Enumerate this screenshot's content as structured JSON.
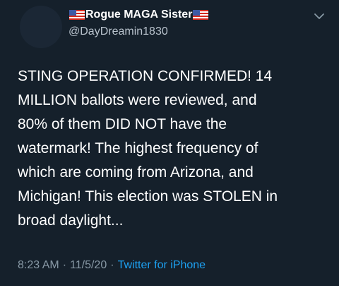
{
  "tweet": {
    "display_name": "Rogue MAGA Sister",
    "handle": "@DayDreamin1830",
    "body": "STING OPERATION CONFIRMED! 14\nMILLION ballots were reviewed, and\n80% of them DID NOT have the\nwatermark! The highest frequency of\nwhich are coming from Arizona, and\nMichigan! This election was STOLEN in\nbroad daylight...",
    "time": "8:23 AM",
    "date": "11/5/20",
    "separator": "·",
    "source": "Twitter for iPhone",
    "name_decoration_icon": "us-flag-icon",
    "menu_icon": "chevron-down-icon"
  },
  "colors": {
    "background": "#15202b",
    "text": "#ffffff",
    "secondary_text": "#8899a6",
    "link": "#1da1f2"
  }
}
